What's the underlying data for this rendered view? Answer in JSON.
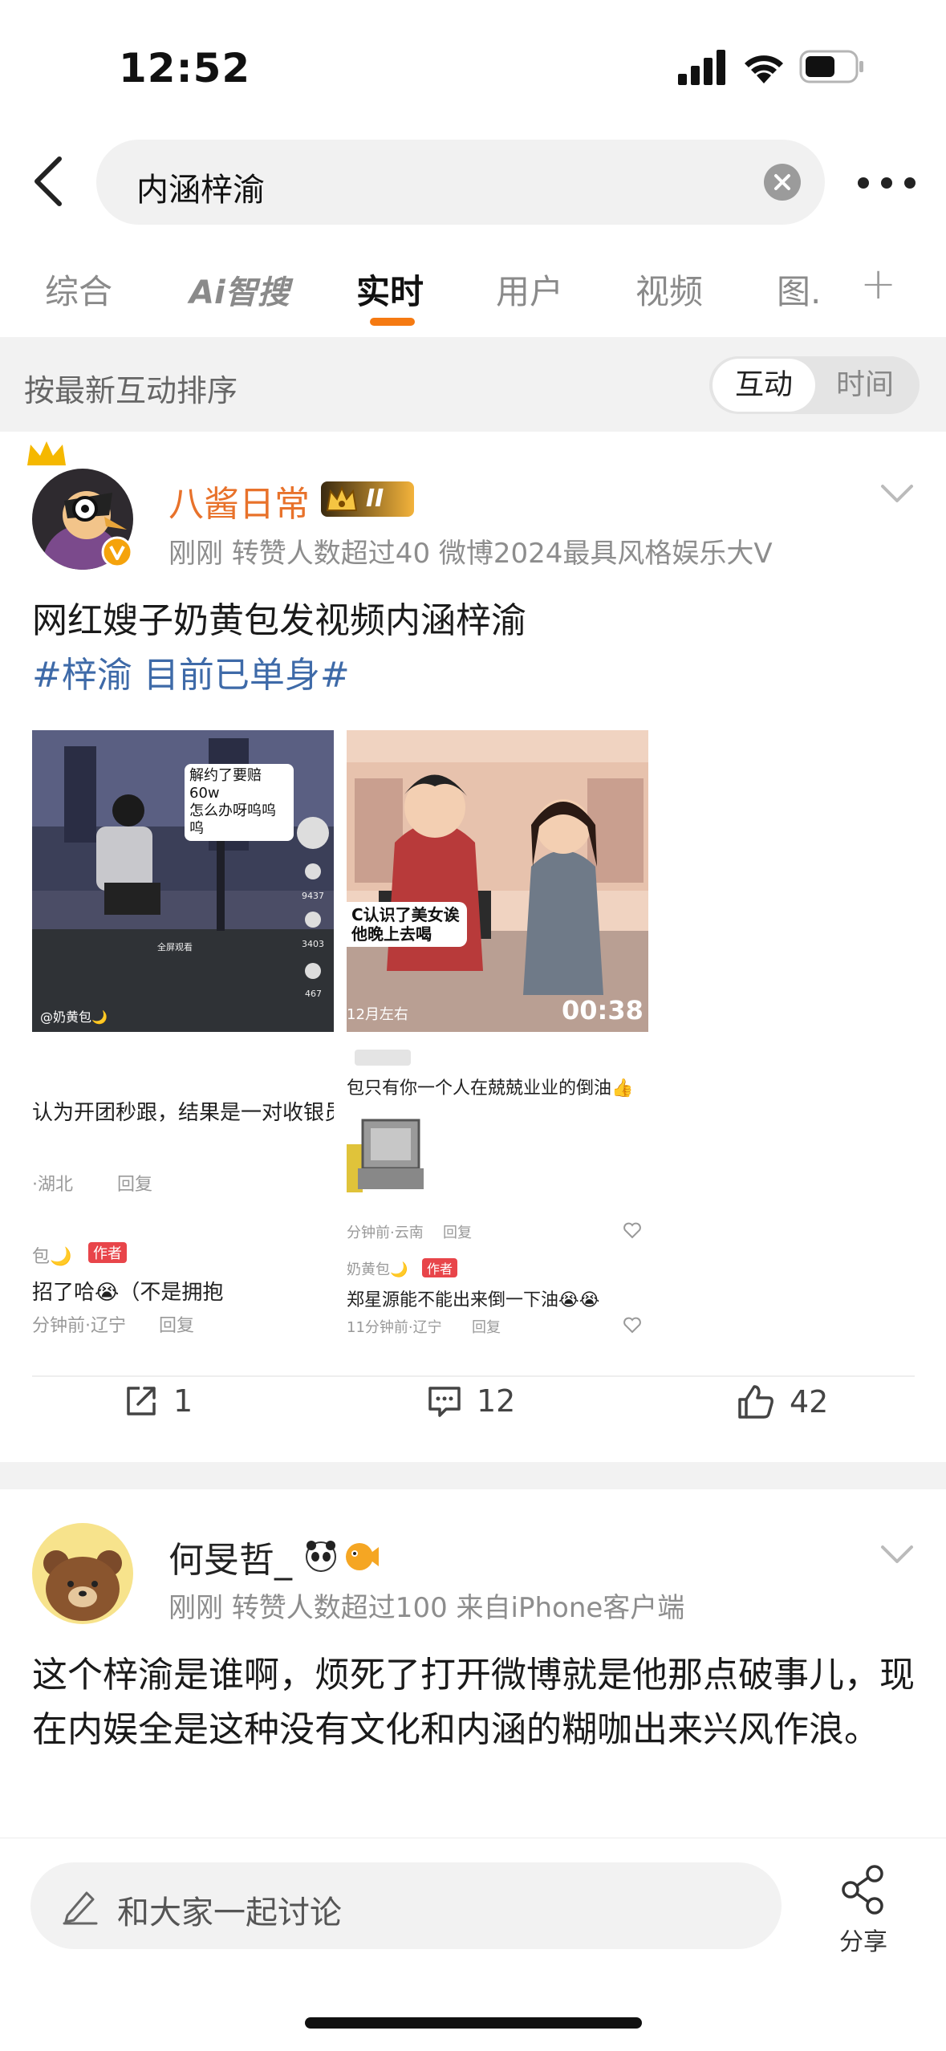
{
  "status_bar": {
    "time": "12:52"
  },
  "search": {
    "query": "内涵梓渝"
  },
  "tabs": [
    {
      "label": "综合"
    },
    {
      "label": "智搜"
    },
    {
      "label": "实时"
    },
    {
      "label": "用户"
    },
    {
      "label": "视频"
    },
    {
      "label": "图."
    }
  ],
  "tab_prefix_ai": "Ai",
  "sort": {
    "label": "按最新互动排序",
    "option_active": "互动",
    "option_inactive": "时间"
  },
  "post1": {
    "author": "八酱日常",
    "badge_level": "II",
    "time": "刚刚",
    "meta": "转赞人数超过40  微博2024最具风格娱乐大V",
    "text": "网红嫂子奶黄包发视频内涵梓渝",
    "hashtag": "#梓渝 目前已单身#",
    "media": {
      "left_caption": "解约了要赔60w\n怎么办呀呜呜呜",
      "left_likes": "9437",
      "left_comments": "3403",
      "left_stars": "467",
      "left_fullscreen": "全屏观看",
      "left_handle": "@奶黄包🌙",
      "right_caption": "C认识了美女诶\n他晚上去喝",
      "right_date": "12月左右",
      "right_duration": "00:38",
      "comment1": "认为开团秒跟，结果是一对收银员",
      "comment1_loc": "·湖北",
      "comment1_reply": "回复",
      "comment2_author": "包🌙",
      "comment2_tag": "作者",
      "comment2": "招了哈😭（不是拥抱",
      "comment2_loc": "分钟前·辽宁",
      "comment2_reply": "回复",
      "comment3": "包只有你一个人在兢兢业业的倒油👍",
      "comment3_loc": "分钟前·云南",
      "comment3_reply": "回复",
      "comment4_author": "奶黄包🌙",
      "comment4_tag": "作者",
      "comment4": "郑星源能不能出来倒一下油😭😭",
      "comment4_loc": "11分钟前·辽宁",
      "comment4_reply": "回复"
    },
    "reposts": "1",
    "comments": "12",
    "likes": "42"
  },
  "post2": {
    "author": "何旻哲_",
    "time": "刚刚",
    "meta": "转赞人数超过100  来自iPhone客户端",
    "text": "这个梓渝是谁啊，烦死了打开微博就是他那点破事儿，现在内娱全是这种没有文化和内涵的糊咖出来兴风作浪。"
  },
  "bottom": {
    "placeholder": "和大家一起讨论",
    "share": "分享"
  },
  "colors": {
    "accent": "#f57a12",
    "hashtag": "#3e6aa8",
    "author_vip": "#e8722b"
  }
}
